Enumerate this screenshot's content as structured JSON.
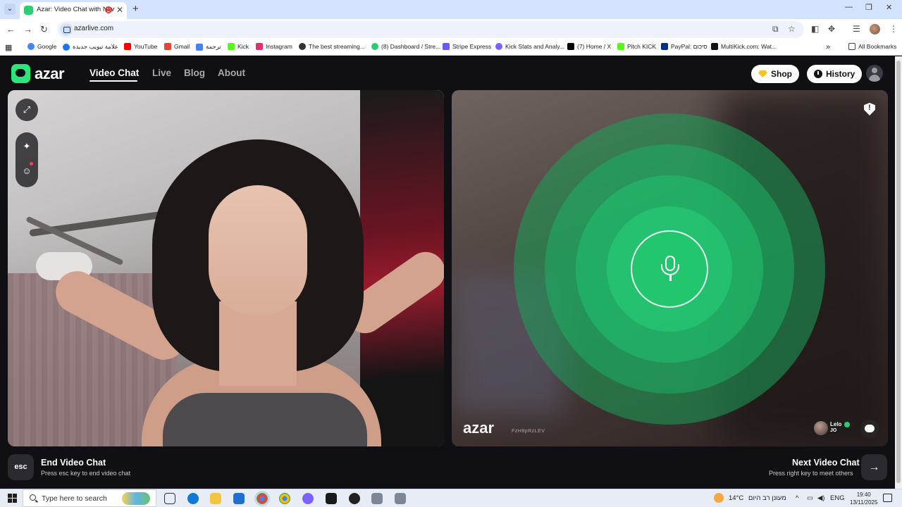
{
  "browser": {
    "tab_title": "Azar: Video Chat with New Friends",
    "url": "azarlive.com",
    "tab_close": "✕",
    "new_tab": "+",
    "window_controls": [
      "—",
      "❐",
      "✕"
    ],
    "bookmarks": [
      {
        "label": "Google",
        "color": "#4285f4"
      },
      {
        "label": "علامة تبويب جديدة",
        "color": "#1877f2"
      },
      {
        "label": "YouTube",
        "color": "#ff0000"
      },
      {
        "label": "Gmail",
        "color": "#ea4335"
      },
      {
        "label": "ترجمة",
        "color": "#4285f4"
      },
      {
        "label": "Kick",
        "color": "#53fc18"
      },
      {
        "label": "Instagram",
        "color": "#e1306c"
      },
      {
        "label": "The best streaming...",
        "color": "#333333"
      },
      {
        "label": "(8) Dashboard / Stre...",
        "color": "#2ecc71"
      },
      {
        "label": "Stripe Express",
        "color": "#635bff"
      },
      {
        "label": "Kick Stats and Analy...",
        "color": "#7b61ff"
      },
      {
        "label": "(7) Home / X",
        "color": "#000000"
      },
      {
        "label": "Pitch KICK",
        "color": "#53fc18"
      },
      {
        "label": "PayPal: סיכום",
        "color": "#003087"
      },
      {
        "label": "MultiKick.com: Wat...",
        "color": "#111111"
      }
    ],
    "all_bookmarks": "All Bookmarks"
  },
  "azar": {
    "logo": "azar",
    "nav": [
      "Video Chat",
      "Live",
      "Blog",
      "About"
    ],
    "shop_label": "Shop",
    "history_label": "History",
    "watermark": "azar",
    "watermark_id": "FzH8pRzLEV",
    "peer": {
      "name": "Lelo",
      "country": "JO"
    },
    "end": {
      "key": "esc",
      "title": "End Video Chat",
      "sub": "Press esc key to end video chat"
    },
    "next": {
      "key": "→",
      "title": "Next Video Chat",
      "sub": "Press right key to meet others"
    }
  },
  "taskbar": {
    "search_placeholder": "Type here to search",
    "weather": "14°C",
    "weather_desc": "מעונן רב היום",
    "lang": "ENG",
    "time": "19:40",
    "date": "13/11/2025"
  },
  "colors": {
    "accent": "#2be67a",
    "mic": "#22c76d"
  }
}
